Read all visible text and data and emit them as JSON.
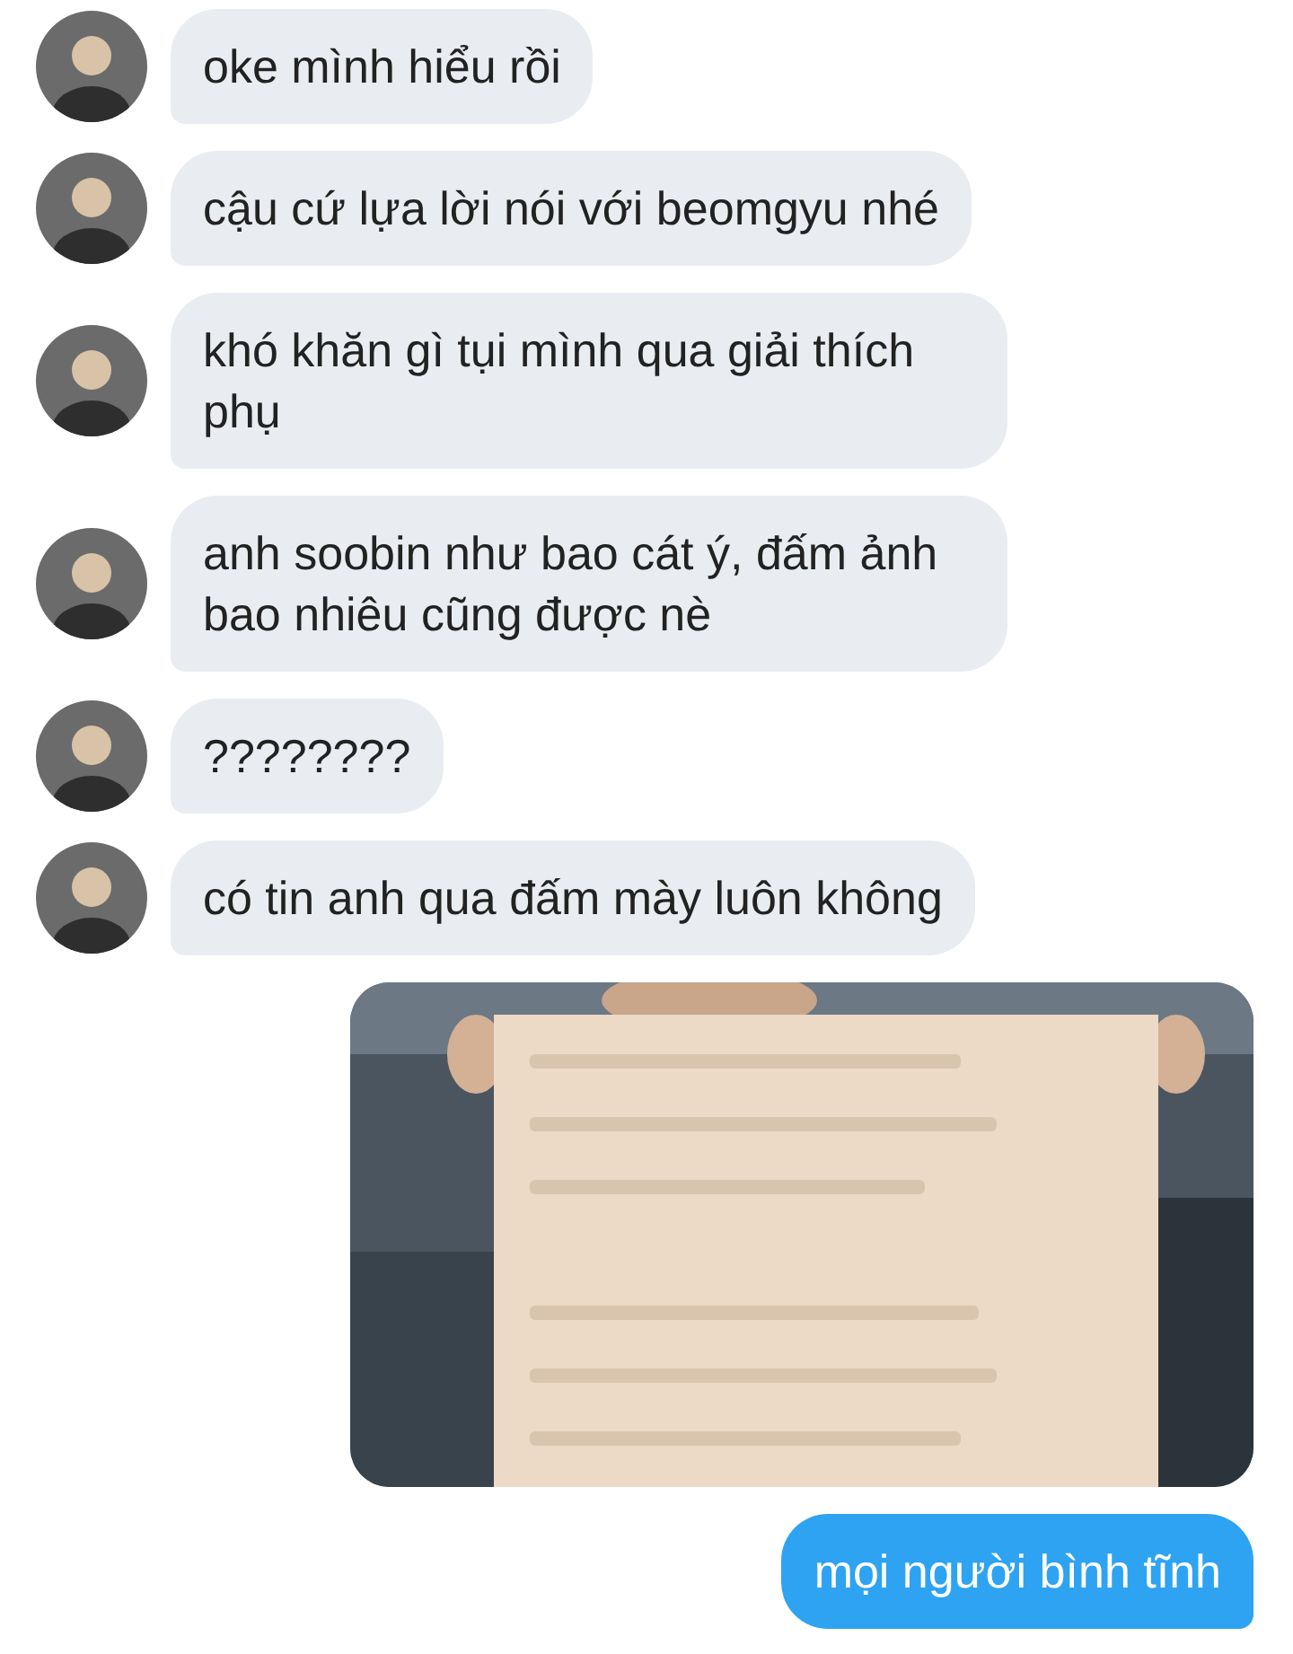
{
  "messages": [
    {
      "outgoing": false,
      "kind": "text",
      "text": "oke mình hiểu rồi"
    },
    {
      "outgoing": false,
      "kind": "text",
      "text": "cậu cứ lựa lời nói với beomgyu nhé"
    },
    {
      "outgoing": false,
      "kind": "text",
      "text": "khó khăn gì tụi mình qua giải thích phụ"
    },
    {
      "outgoing": false,
      "kind": "text",
      "text": "anh soobin như bao cát ý, đấm ảnh bao nhiêu cũng được nè"
    },
    {
      "outgoing": false,
      "kind": "text",
      "text": "????????"
    },
    {
      "outgoing": false,
      "kind": "text",
      "text": "có tin anh qua đấm mày luôn không"
    },
    {
      "outgoing": true,
      "kind": "picture"
    },
    {
      "outgoing": true,
      "kind": "text",
      "text": "mọi người bình tĩnh"
    }
  ]
}
